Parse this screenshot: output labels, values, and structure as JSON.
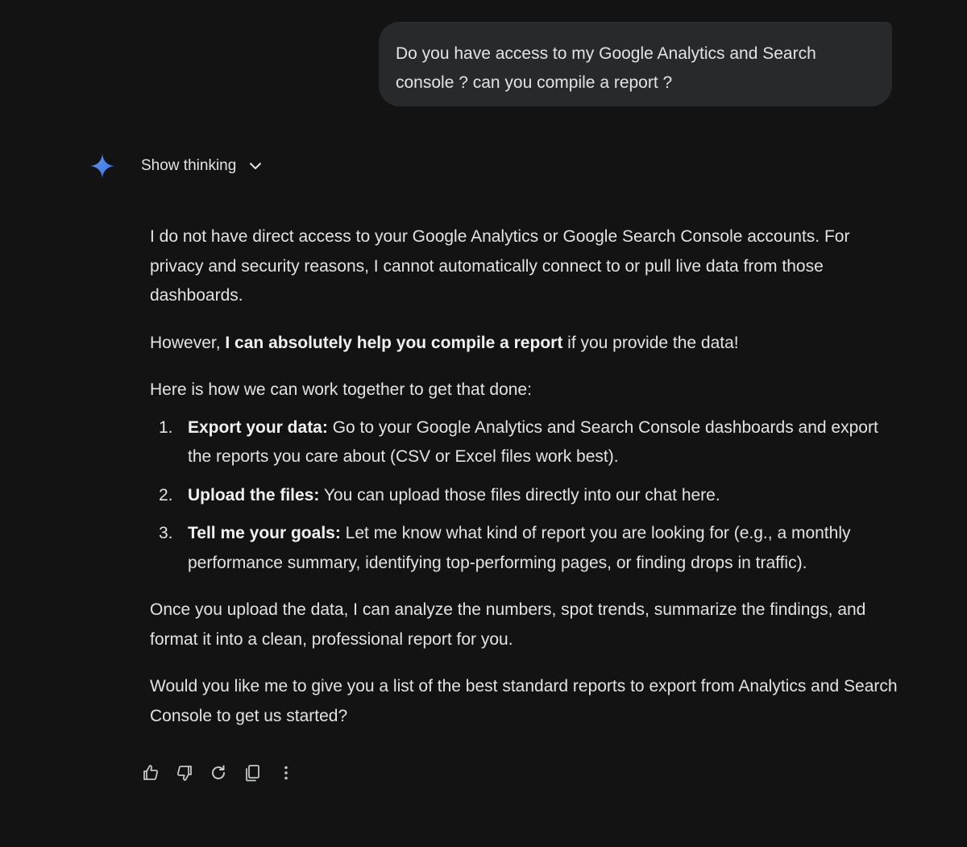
{
  "user_message": {
    "text": "Do you have access to my Google Analytics and Search console ? can you compile a report ?"
  },
  "thinking": {
    "label": "Show thinking",
    "icon": "chevron-down-icon"
  },
  "assistant_icon": "gemini-sparkle-icon",
  "colors": {
    "background": "#131314",
    "bubble": "#28292b",
    "text": "#e3e3e3",
    "sparkle_start": "#4a8bf5",
    "sparkle_end": "#3b6fd8"
  },
  "response": {
    "para1": "I do not have direct access to your Google Analytics or Google Search Console accounts. For privacy and security reasons, I cannot automatically connect to or pull live data from those dashboards.",
    "para2_before": "However, ",
    "para2_bold": "I can absolutely help you compile a report",
    "para2_after": " if you provide the data!",
    "para3": "Here is how we can work together to get that done:",
    "steps": [
      {
        "number": "1.",
        "title": "Export your data:",
        "text": " Go to your Google Analytics and Search Console dashboards and export the reports you care about (CSV or Excel files work best)."
      },
      {
        "number": "2.",
        "title": "Upload the files:",
        "text": " You can upload those files directly into our chat here."
      },
      {
        "number": "3.",
        "title": "Tell me your goals:",
        "text": " Let me know what kind of report you are looking for (e.g., a monthly performance summary, identifying top-performing pages, or finding drops in traffic)."
      }
    ],
    "para4": "Once you upload the data, I can analyze the numbers, spot trends, summarize the findings, and format it into a clean, professional report for you.",
    "para5": "Would you like me to give you a list of the best standard reports to export from Analytics and Search Console to get us started?"
  },
  "actions": [
    "thumbs-up-icon",
    "thumbs-down-icon",
    "regenerate-icon",
    "copy-icon",
    "more-options-icon"
  ]
}
